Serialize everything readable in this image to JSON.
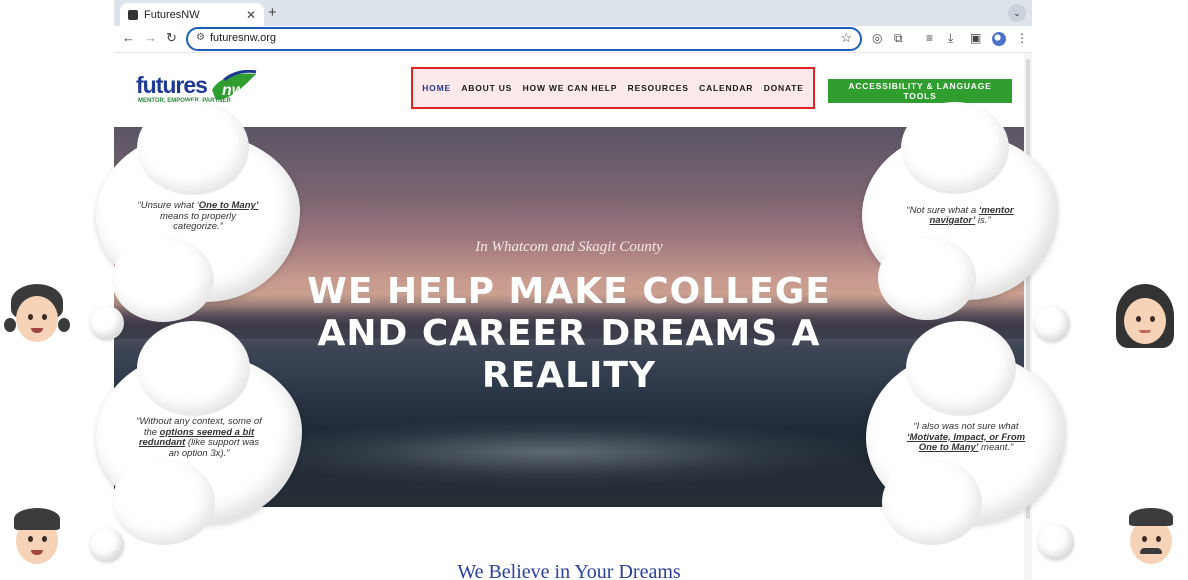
{
  "browser": {
    "tab_title": "FuturesNW",
    "tab_close": "✕",
    "new_tab": "+",
    "tab_dropdown": "⌄",
    "url": "futuresnw.org",
    "icons": [
      "back-icon",
      "forward-icon",
      "reload-icon",
      "site-info-icon",
      "bookmark-star-icon",
      "screenshot-icon",
      "extensions-icon",
      "media-icon",
      "download-icon",
      "sidebar-icon",
      "profile-icon",
      "menu-icon"
    ]
  },
  "site": {
    "logo": {
      "name_part1": "futures",
      "name_part2": "nw",
      "tagline": "MENTOR, EMPOWER, PARTNER"
    },
    "nav": [
      {
        "label": "HOME"
      },
      {
        "label": "ABOUT US"
      },
      {
        "label": "HOW WE CAN HELP"
      },
      {
        "label": "RESOURCES"
      },
      {
        "label": "CALENDAR"
      },
      {
        "label": "DONATE"
      }
    ],
    "cta_label": "ACCESSIBILITY & LANGUAGE TOOLS",
    "hero": {
      "subtitle": "In Whatcom and Skagit County",
      "title": "WE HELP MAKE COLLEGE AND CAREER DREAMS A REALITY"
    },
    "below_heading": "We Believe in Your Dreams"
  },
  "colors": {
    "brand_blue": "#1f3a93",
    "brand_green": "#2f9e2f",
    "nav_highlight_border": "#e02424",
    "nav_highlight_fill": "#fde9ea"
  },
  "thoughts": [
    {
      "pre": "“Unsure what ‘",
      "bold": "One to Many’",
      "post": " means to properly categorize.”"
    },
    {
      "pre": "“Without any context, some of the ",
      "bold": "options seemed a bit redundant",
      "post": " (like support was an option 3x).”"
    },
    {
      "pre": "“Not sure what a ",
      "bold": "‘mentor navigator’",
      "post": " is.”"
    },
    {
      "pre": "“I also was not sure what ",
      "bold": "‘Motivate, Impact, or From One to Many’",
      "post": " meant.”"
    }
  ]
}
